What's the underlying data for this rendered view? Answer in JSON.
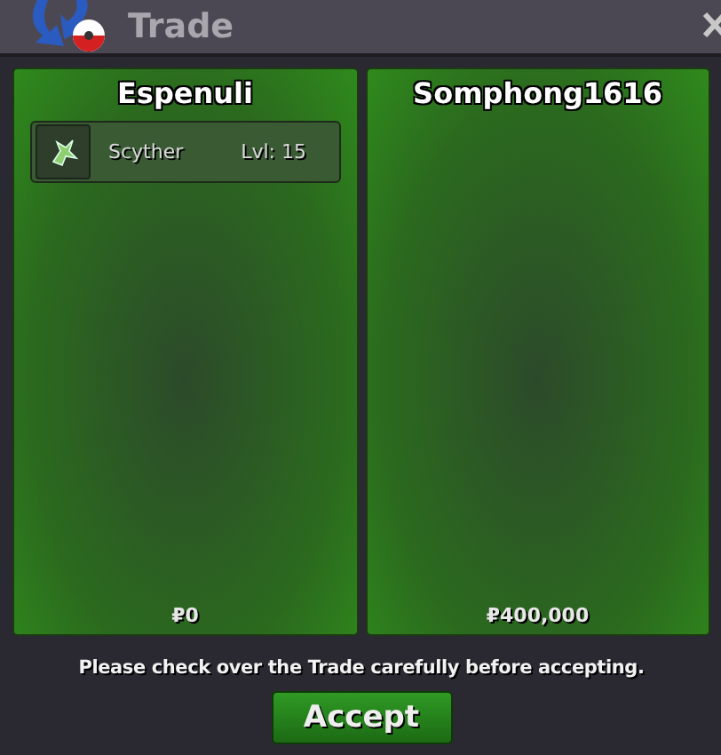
{
  "window": {
    "title": "Trade"
  },
  "panels": [
    {
      "player": "Espenuli",
      "items": [
        {
          "name": "Scyther",
          "level": "Lvl: 15"
        }
      ],
      "money": "₽0"
    },
    {
      "player": "Somphong1616",
      "money": "₽400,000"
    }
  ],
  "notice": "Please check over the Trade carefully before accepting.",
  "accept_button": "Accept"
}
